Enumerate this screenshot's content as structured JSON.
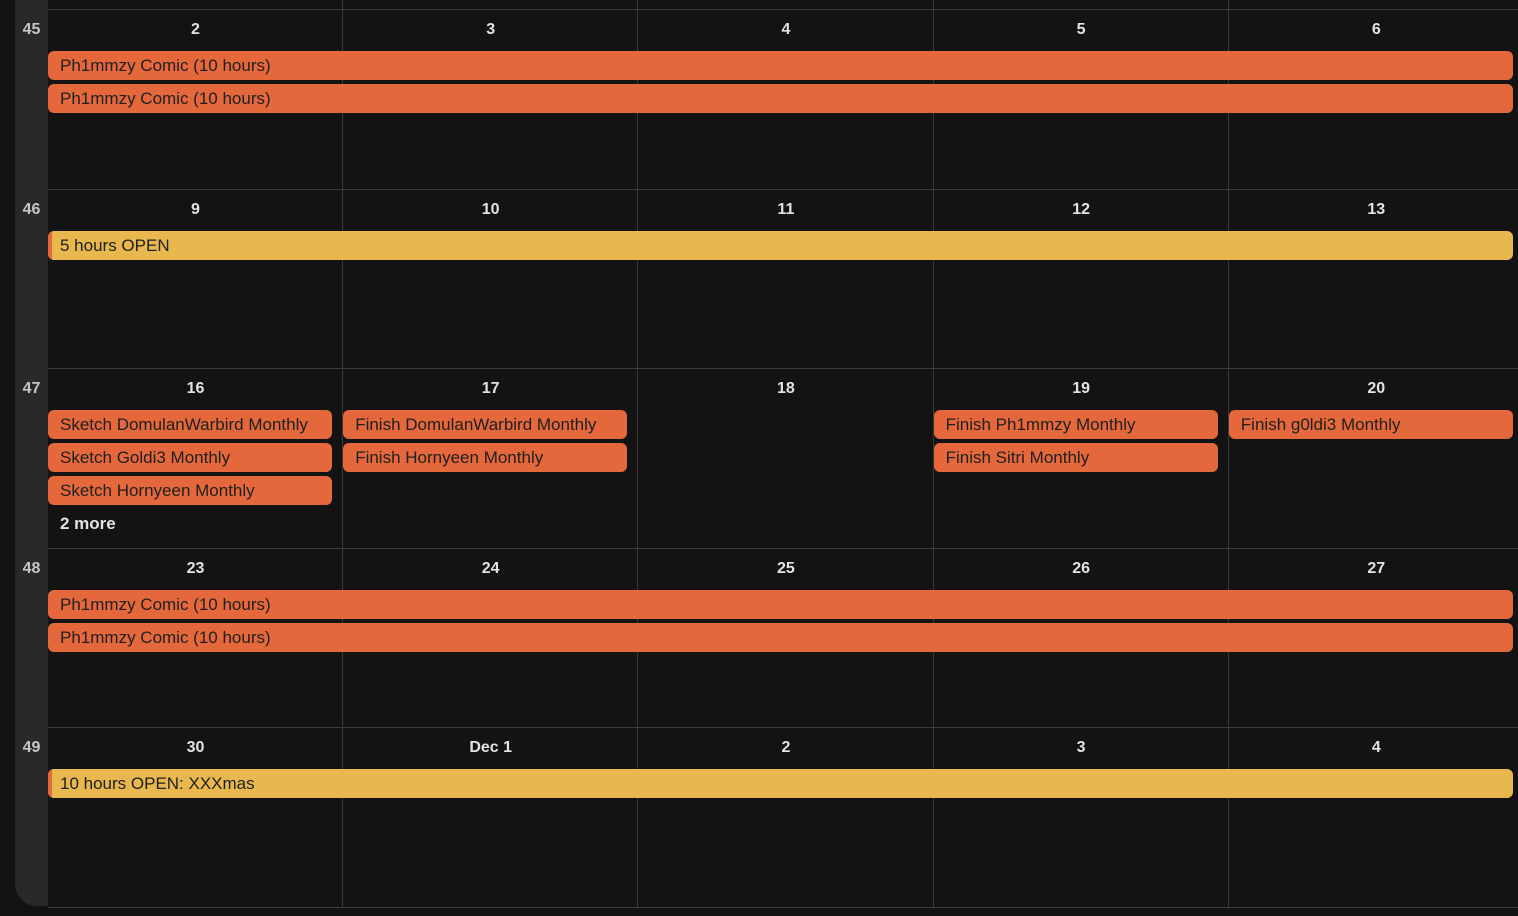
{
  "colors": {
    "orange": "#e4683c",
    "yellow": "#e8b84e",
    "background": "#131314"
  },
  "weeks": [
    {
      "number": "45",
      "days": [
        "2",
        "3",
        "4",
        "5",
        "6"
      ],
      "events": [
        {
          "title": "Ph1mmzy Comic (10 hours)",
          "color": "orange",
          "startCol": 0,
          "span": 5,
          "row": 0
        },
        {
          "title": "Ph1mmzy Comic (10 hours)",
          "color": "orange",
          "startCol": 0,
          "span": 5,
          "row": 1
        }
      ]
    },
    {
      "number": "46",
      "days": [
        "9",
        "10",
        "11",
        "12",
        "13"
      ],
      "events": [
        {
          "title": "5 hours OPEN",
          "color": "yellow",
          "startCol": 0,
          "span": 5,
          "row": 0
        }
      ]
    },
    {
      "number": "47",
      "days": [
        "16",
        "17",
        "18",
        "19",
        "20"
      ],
      "events": [
        {
          "title": "Sketch DomulanWarbird Monthly",
          "color": "orange",
          "startCol": 0,
          "span": 1,
          "row": 0
        },
        {
          "title": "Sketch Goldi3 Monthly",
          "color": "orange",
          "startCol": 0,
          "span": 1,
          "row": 1
        },
        {
          "title": "Sketch Hornyeen Monthly",
          "color": "orange",
          "startCol": 0,
          "span": 1,
          "row": 2
        },
        {
          "title": "Finish DomulanWarbird Monthly",
          "color": "orange",
          "startCol": 1,
          "span": 1,
          "row": 0
        },
        {
          "title": "Finish Hornyeen Monthly",
          "color": "orange",
          "startCol": 1,
          "span": 1,
          "row": 1
        },
        {
          "title": "Finish Ph1mmzy Monthly",
          "color": "orange",
          "startCol": 3,
          "span": 1,
          "row": 0
        },
        {
          "title": "Finish Sitri Monthly",
          "color": "orange",
          "startCol": 3,
          "span": 1,
          "row": 1
        },
        {
          "title": "Finish g0ldi3 Monthly",
          "color": "orange",
          "startCol": 4,
          "span": 1,
          "row": 0
        }
      ],
      "more": [
        {
          "label": "2 more",
          "col": 0,
          "row": 3
        }
      ]
    },
    {
      "number": "48",
      "days": [
        "23",
        "24",
        "25",
        "26",
        "27"
      ],
      "events": [
        {
          "title": "Ph1mmzy Comic (10 hours)",
          "color": "orange",
          "startCol": 0,
          "span": 5,
          "row": 0
        },
        {
          "title": "Ph1mmzy Comic (10 hours)",
          "color": "orange",
          "startCol": 0,
          "span": 5,
          "row": 1
        }
      ]
    },
    {
      "number": "49",
      "days": [
        "30",
        "Dec 1",
        "2",
        "3",
        "4"
      ],
      "events": [
        {
          "title": "10 hours OPEN: XXXmas",
          "color": "yellow",
          "startCol": 0,
          "span": 5,
          "row": 0
        }
      ]
    }
  ]
}
